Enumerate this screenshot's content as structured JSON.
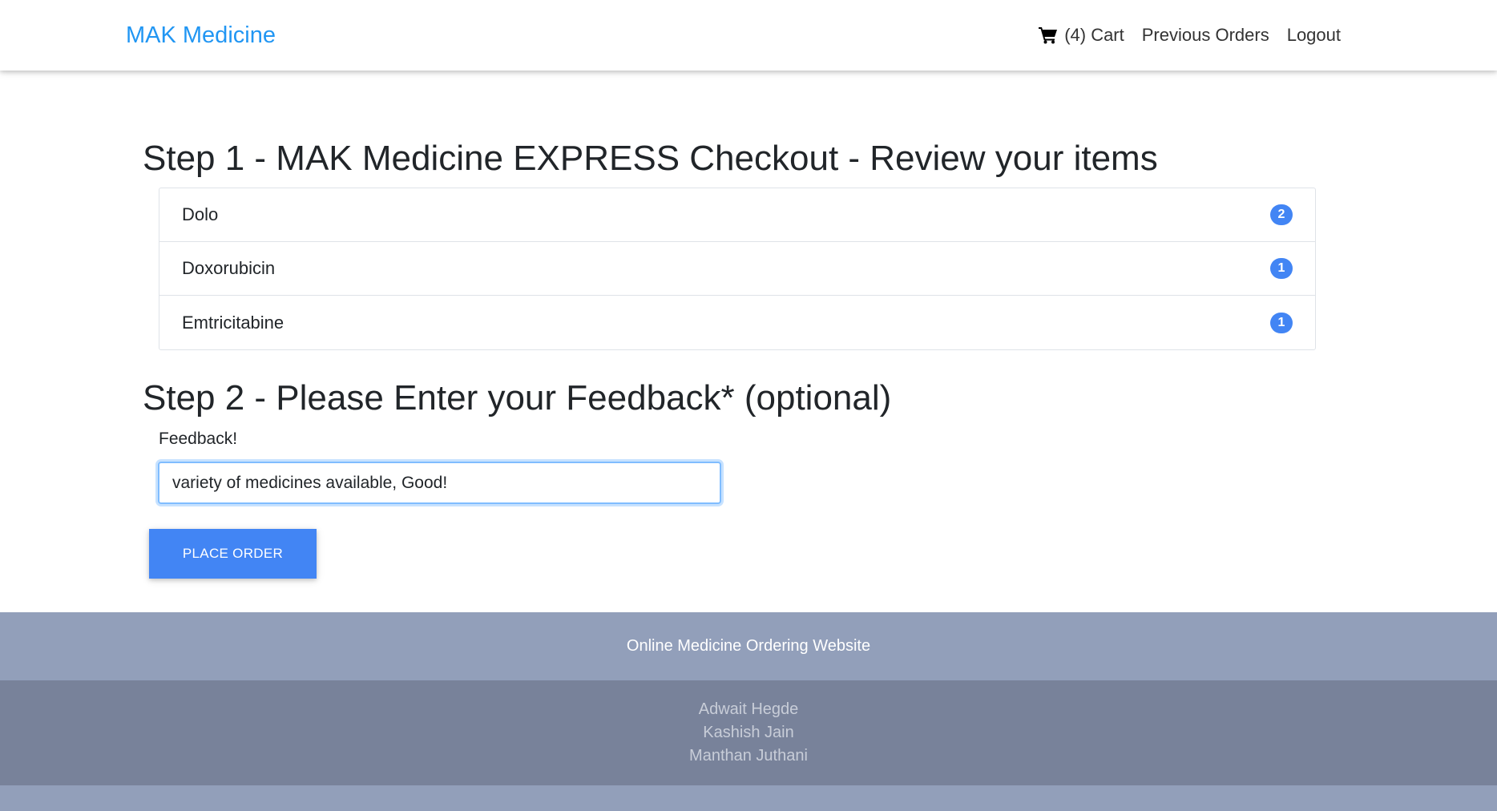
{
  "navbar": {
    "brand": "MAK Medicine",
    "cart_label": "(4) Cart",
    "previous_orders": "Previous Orders",
    "logout": "Logout",
    "cart_icon": "shopping-cart-icon"
  },
  "checkout": {
    "step1_heading": "Step 1 - MAK Medicine EXPRESS Checkout - Review your items",
    "items": [
      {
        "name": "Dolo",
        "qty": "2"
      },
      {
        "name": "Doxorubicin",
        "qty": "1"
      },
      {
        "name": "Emtricitabine",
        "qty": "1"
      }
    ],
    "step2_heading": "Step 2 - Please Enter your Feedback* (optional)",
    "feedback_label": "Feedback!",
    "feedback_value": "variety of medicines available, Good!",
    "place_order": "PLACE ORDER"
  },
  "footer": {
    "tagline": "Online Medicine Ordering Website",
    "authors": [
      "Adwait Hegde",
      "Kashish Jain",
      "Manthan Juthani"
    ]
  },
  "colors": {
    "brand": "#2196f3",
    "button": "#4285f4",
    "badge": "#4285f4",
    "footer_top": "#929fba",
    "footer_bottom": "#78829a"
  }
}
